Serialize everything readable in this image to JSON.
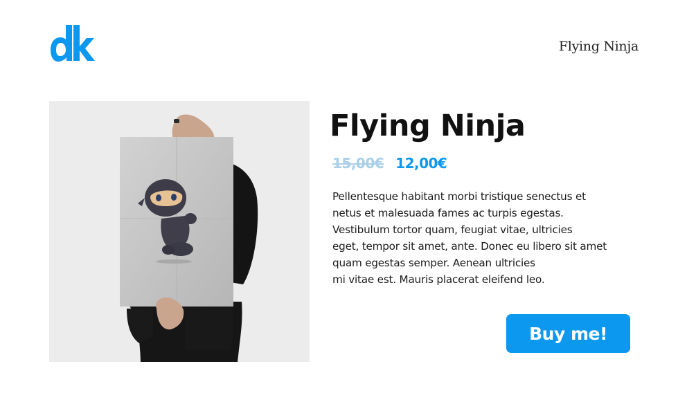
{
  "header": {
    "logo_text": "dk",
    "nav_title": "Flying Ninja"
  },
  "colors": {
    "accent": "#0c98ef",
    "old_price": "#a9cfe9",
    "image_background": "#ececec"
  },
  "product": {
    "image_icon": "ninja-poster-image",
    "title": "Flying Ninja",
    "old_price": "15,00€",
    "price": "12,00€",
    "description_lines": [
      "Pellentesque habitant morbi tristique senectus et",
      "netus et malesuada fames ac turpis egestas.",
      "Vestibulum tortor quam, feugiat vitae, ultricies",
      "eget, tempor sit amet, ante. Donec eu libero sit amet",
      "quam egestas semper. Aenean ultricies",
      "mi vitae est. Mauris placerat eleifend leo."
    ],
    "buy_label": "Buy me!"
  }
}
